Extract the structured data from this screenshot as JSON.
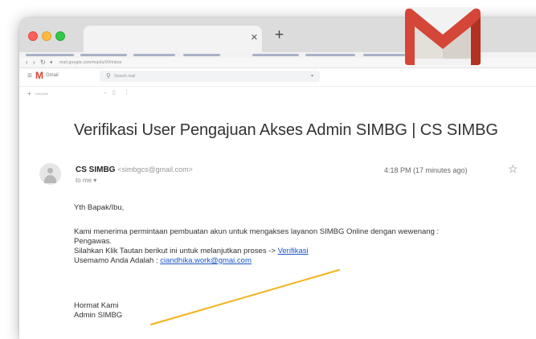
{
  "browser": {
    "tab_close_glyph": "×",
    "new_tab_glyph": "+",
    "address_url": "mail.google.com/mail/u/0/#inbox"
  },
  "gmail": {
    "app_name": "Gmail",
    "search_placeholder": "Search mail",
    "compose_label": "Compose"
  },
  "email": {
    "subject": "Verifikasi User Pengajuan Akses Admin SIMBG | CS SIMBG",
    "sender_name": "CS SIMBG",
    "sender_email": "<simbgcs@gmail.com>",
    "to": "to me ▾",
    "time": "4:18 PM (17 minutes ago)",
    "greeting": "Yth Bapak/Ibu,",
    "para1_line1": "Kami menerima permintaan pembuatan akun untuk mengakses layanon SIMBG Online dengan wewenang :",
    "para1_line2": "Pengawas.",
    "para2_prefix": "Silahkan Klik Tautan berikut ini untuk melanjutkan proses -> ",
    "verify_link": "Verifikasi",
    "username_prefix": "Usemamo Anda Adalah : ",
    "username_link": "ciandhika.work@gmai.com",
    "closing": "Hormat Kami",
    "signature": "Admin SIMBG"
  },
  "colors": {
    "gmail_red": "#d44638",
    "link_blue": "#1a56c6",
    "pointer_orange": "#f2b21b"
  },
  "icons": [
    "close-icon",
    "plus-icon",
    "menu-icon",
    "gmail-m-icon",
    "search-icon",
    "person-icon",
    "star-icon",
    "gmail-logo"
  ]
}
